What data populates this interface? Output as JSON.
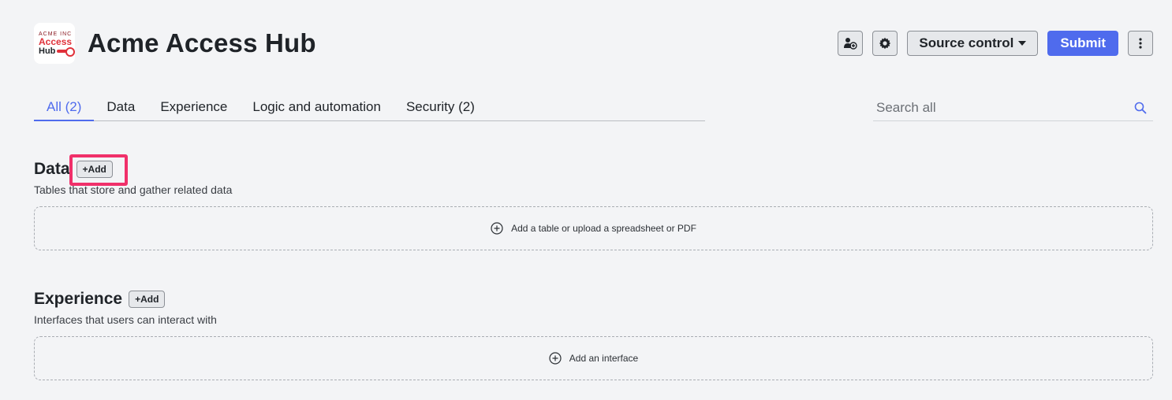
{
  "app": {
    "title": "Acme Access Hub",
    "logo": {
      "line1": "ACME INC",
      "line2": "Access",
      "line3": "Hub"
    }
  },
  "header": {
    "source_control_label": "Source control",
    "submit_label": "Submit"
  },
  "tabs": [
    {
      "label": "All (2)",
      "active": true
    },
    {
      "label": "Data"
    },
    {
      "label": "Experience"
    },
    {
      "label": "Logic and automation"
    },
    {
      "label": "Security (2)"
    }
  ],
  "search": {
    "placeholder": "Search all"
  },
  "sections": {
    "data": {
      "title": "Data",
      "add_label": "+Add",
      "description": "Tables that store and gather related data",
      "dropzone_label": "Add a table or upload a spreadsheet or PDF"
    },
    "experience": {
      "title": "Experience",
      "add_label": "+Add",
      "description": "Interfaces that users can interact with",
      "dropzone_label": "Add an interface"
    }
  },
  "colors": {
    "accent": "#4f6bed",
    "highlight": "#f0306a",
    "background": "#f3f4f6"
  }
}
